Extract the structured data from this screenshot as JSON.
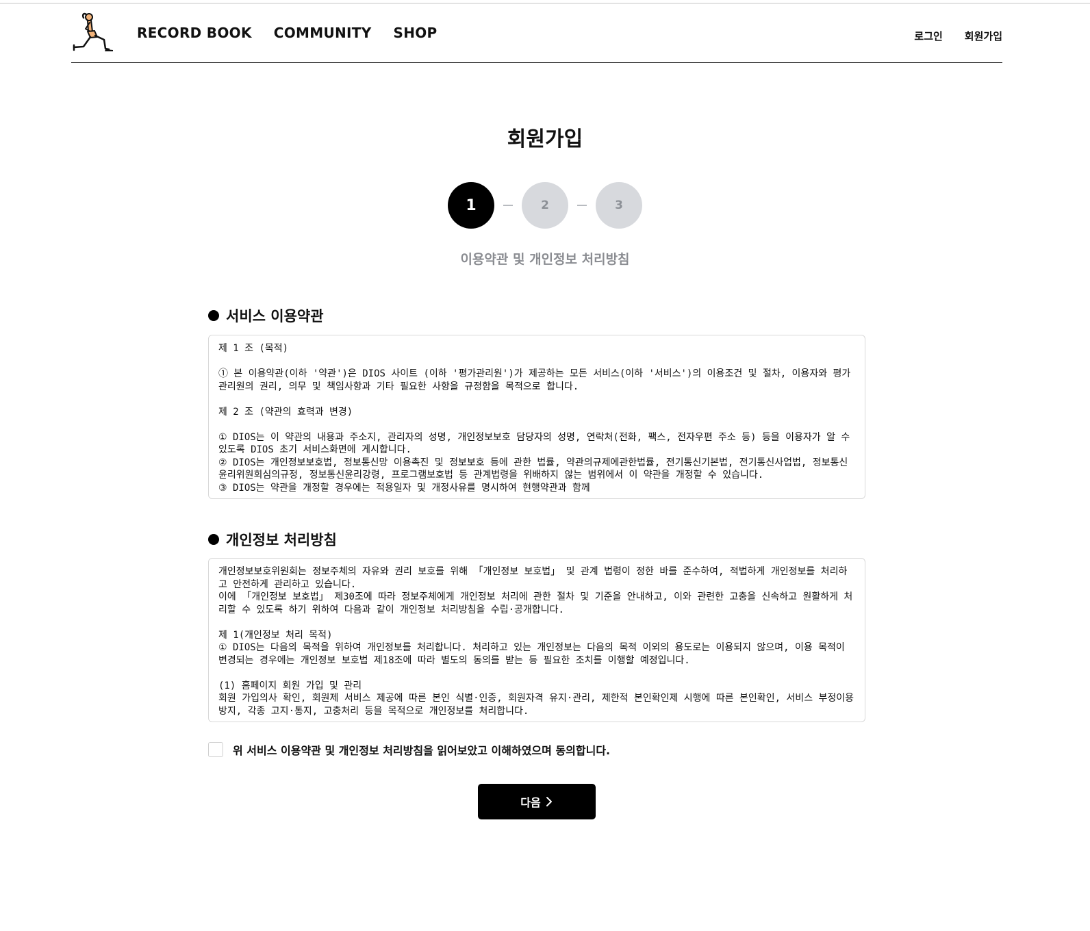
{
  "header": {
    "nav": [
      {
        "label": "RECORD BOOK"
      },
      {
        "label": "COMMUNITY"
      },
      {
        "label": "SHOP"
      }
    ],
    "auth": {
      "login": "로그인",
      "signup": "회원가입"
    }
  },
  "page": {
    "title": "회원가입",
    "steps": [
      "1",
      "2",
      "3"
    ],
    "current_step": 1,
    "step_caption": "이용약관 및 개인정보 처리방침"
  },
  "terms": {
    "title": "서비스 이용약관",
    "body": "제 1 조 (목적)\n\n① 본 이용약관(이하 '약관')은 DIOS 사이트 (이하 '평가관리원')가 제공하는 모든 서비스(이하 '서비스')의 이용조건 및 절차, 이용자와 평가관리원의 권리, 의무 및 책임사항과 기타 필요한 사항을 규정함을 목적으로 합니다.\n\n제 2 조 (약관의 효력과 변경)\n\n① DIOS는 이 약관의 내용과 주소지, 관리자의 성명, 개인정보보호 담당자의 성명, 연락처(전화, 팩스, 전자우편 주소 등) 등을 이용자가 알 수 있도록 DIOS 초기 서비스화면에 게시합니다.\n② DIOS는 개인정보보호법, 정보통신망 이용촉진 및 정보보호 등에 관한 법률, 약관의규제에관한법률, 전기통신기본법, 전기통신사업법, 정보통신윤리위원회심의규정, 정보통신윤리강령, 프로그램보호법 등 관계법령을 위배하지 않는 범위에서 이 약관을 개정할 수 있습니다.\n③ DIOS는 약관을 개정할 경우에는 적용일자 및 개정사유를 명시하여 현행약관과 함께"
  },
  "privacy": {
    "title": "개인정보 처리방침",
    "body": "개인정보보호위원회는 정보주체의 자유와 권리 보호를 위해 「개인정보 보호법」 및 관계 법령이 정한 바를 준수하여, 적법하게 개인정보를 처리하고 안전하게 관리하고 있습니다.\n이에 「개인정보 보호법」 제30조에 따라 정보주체에게 개인정보 처리에 관한 절차 및 기준을 안내하고, 이와 관련한 고충을 신속하고 원활하게 처리할 수 있도록 하기 위하여 다음과 같이 개인정보 처리방침을 수립·공개합니다.\n\n제 1(개인정보 처리 목적)\n① DIOS는 다음의 목적을 위하여 개인정보를 처리합니다. 처리하고 있는 개인정보는 다음의 목적 이외의 용도로는 이용되지 않으며, 이용 목적이 변경되는 경우에는 개인정보 보호법 제18조에 따라 별도의 동의를 받는 등 필요한 조치를 이행할 예정입니다.\n\n(1) 홈페이지 회원 가입 및 관리\n회원 가입의사 확인, 회원제 서비스 제공에 따른 본인 식별·인증, 회원자격 유지·관리, 제한적 본인확인제 시행에 따른 본인확인, 서비스 부정이용 방지, 각종 고지·통지, 고충처리 등을 목적으로 개인정보를 처리합니다."
  },
  "agreement": {
    "label": "위 서비스 이용약관 및 개인정보 처리방침을 읽어보았고 이해하였으며 동의합니다.",
    "checked": false
  },
  "next_button": {
    "label": "다음"
  },
  "icons": {
    "logo": "lunge-person-logo-icon",
    "next": "chevron-right-icon",
    "bullet": "filled-circle-bullet-icon"
  },
  "colors": {
    "accent": "#000000",
    "step_inactive_bg": "#d7d9dd",
    "step_inactive_text": "#8c9096",
    "caption": "#8a8c91",
    "logo_skin": "#f2b37a"
  }
}
